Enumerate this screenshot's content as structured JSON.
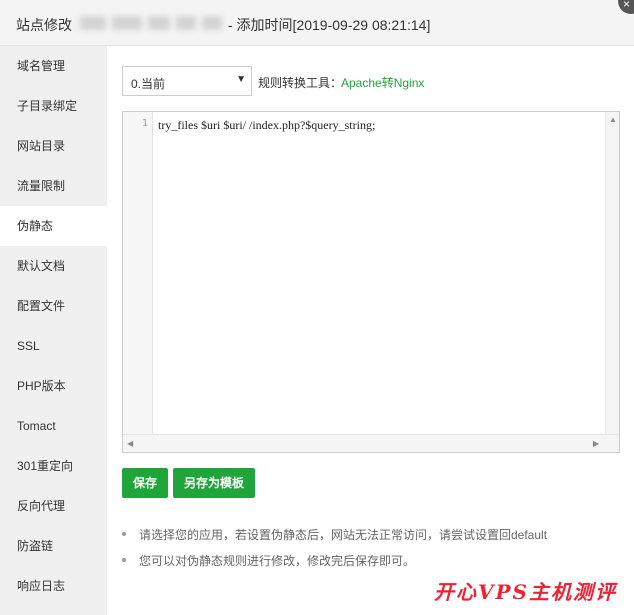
{
  "titlebar": {
    "prefix": "站点修改",
    "suffix": "- 添加时间[2019-09-29 08:21:14]"
  },
  "sidebar": {
    "items": [
      {
        "label": "域名管理"
      },
      {
        "label": "子目录绑定"
      },
      {
        "label": "网站目录"
      },
      {
        "label": "流量限制"
      },
      {
        "label": "伪静态",
        "active": true
      },
      {
        "label": "默认文档"
      },
      {
        "label": "配置文件"
      },
      {
        "label": "SSL"
      },
      {
        "label": "PHP版本"
      },
      {
        "label": "Tomact"
      },
      {
        "label": "301重定向"
      },
      {
        "label": "反向代理"
      },
      {
        "label": "防盗链"
      },
      {
        "label": "响应日志"
      }
    ]
  },
  "rewrite": {
    "select_value": "0.当前",
    "tool_label": "规则转换工具：",
    "tool_link": "Apache转Nginx"
  },
  "editor": {
    "line_number": "1",
    "code": "try_files $uri $uri/ /index.php?$query_string;"
  },
  "buttons": {
    "save": "保存",
    "save_template": "另存为模板"
  },
  "tips": [
    "请选择您的应用，若设置伪静态后，网站无法正常访问，请尝试设置回default",
    "您可以对伪静态规则进行修改，修改完后保存即可。"
  ],
  "watermark": "开心VPS主机测评",
  "colors": {
    "accent": "#20a53a",
    "watermark": "#e22233"
  }
}
